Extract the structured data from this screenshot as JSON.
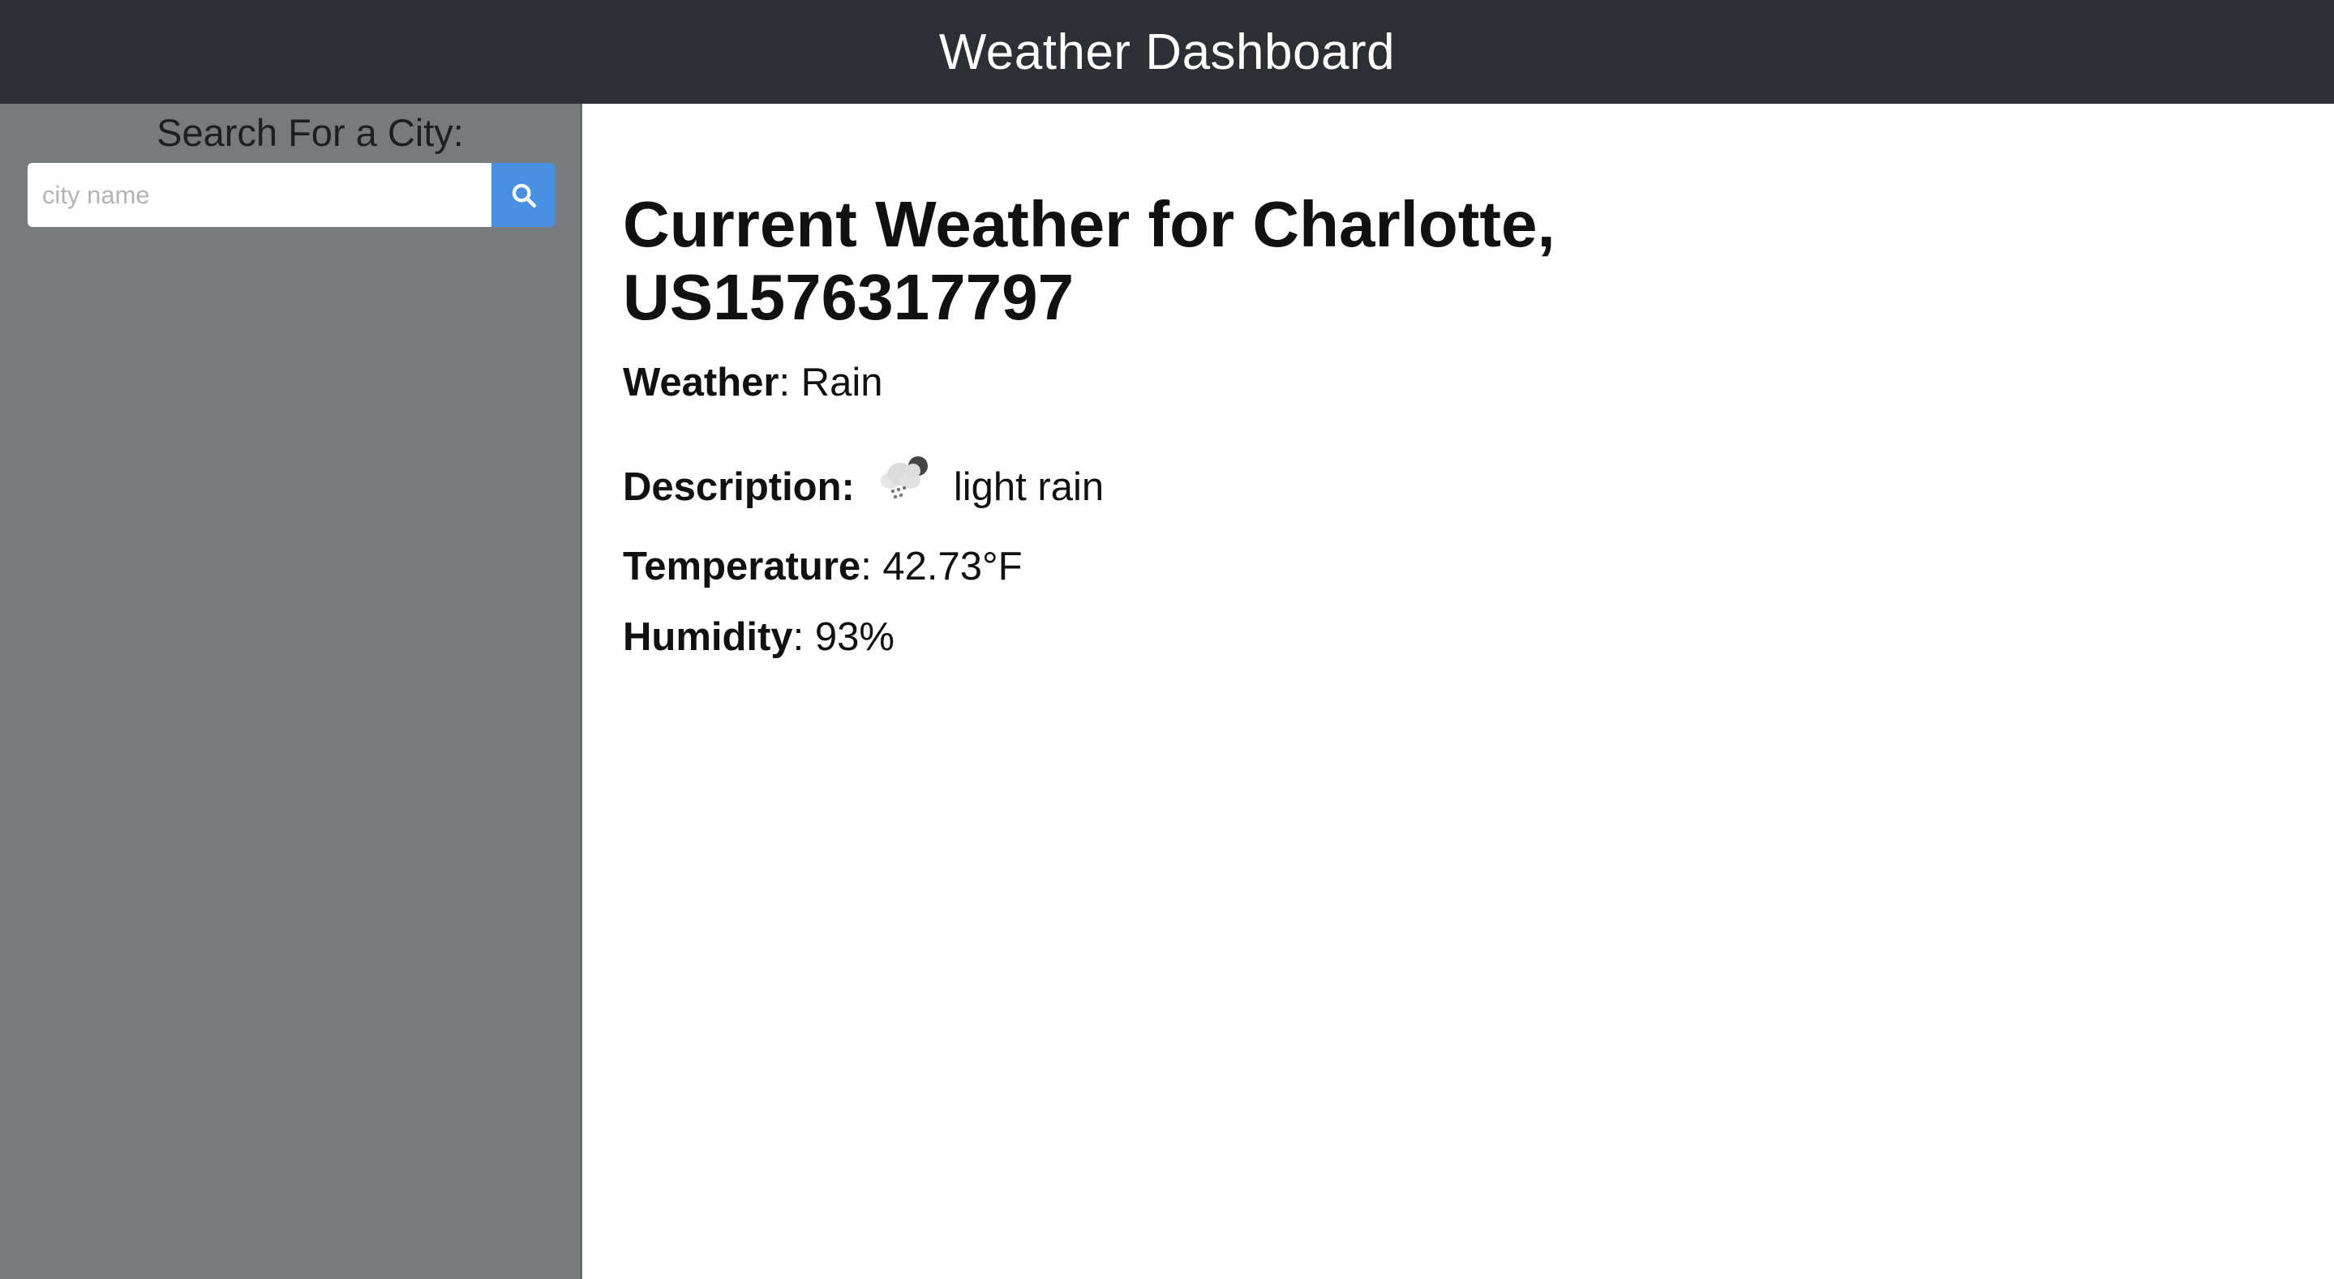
{
  "header": {
    "title": "Weather Dashboard"
  },
  "sidebar": {
    "title": "Search For a City:",
    "search": {
      "placeholder": "city name",
      "value": ""
    },
    "search_button_icon": "search-icon"
  },
  "main": {
    "title": "Current Weather for Charlotte, US1576317797",
    "weather": {
      "label": "Weather",
      "separator": ":",
      "value": " Rain"
    },
    "description": {
      "label": "Description:",
      "value": "light rain",
      "icon": "light-rain-icon"
    },
    "temperature": {
      "label": "Temperature",
      "separator": ":",
      "value": " 42.73°F"
    },
    "humidity": {
      "label": "Humidity",
      "separator": ":",
      "value": " 93%"
    }
  },
  "colors": {
    "header_bg": "#2c2f34",
    "sidebar_bg": "#787a7c",
    "accent": "#4a90e2"
  }
}
